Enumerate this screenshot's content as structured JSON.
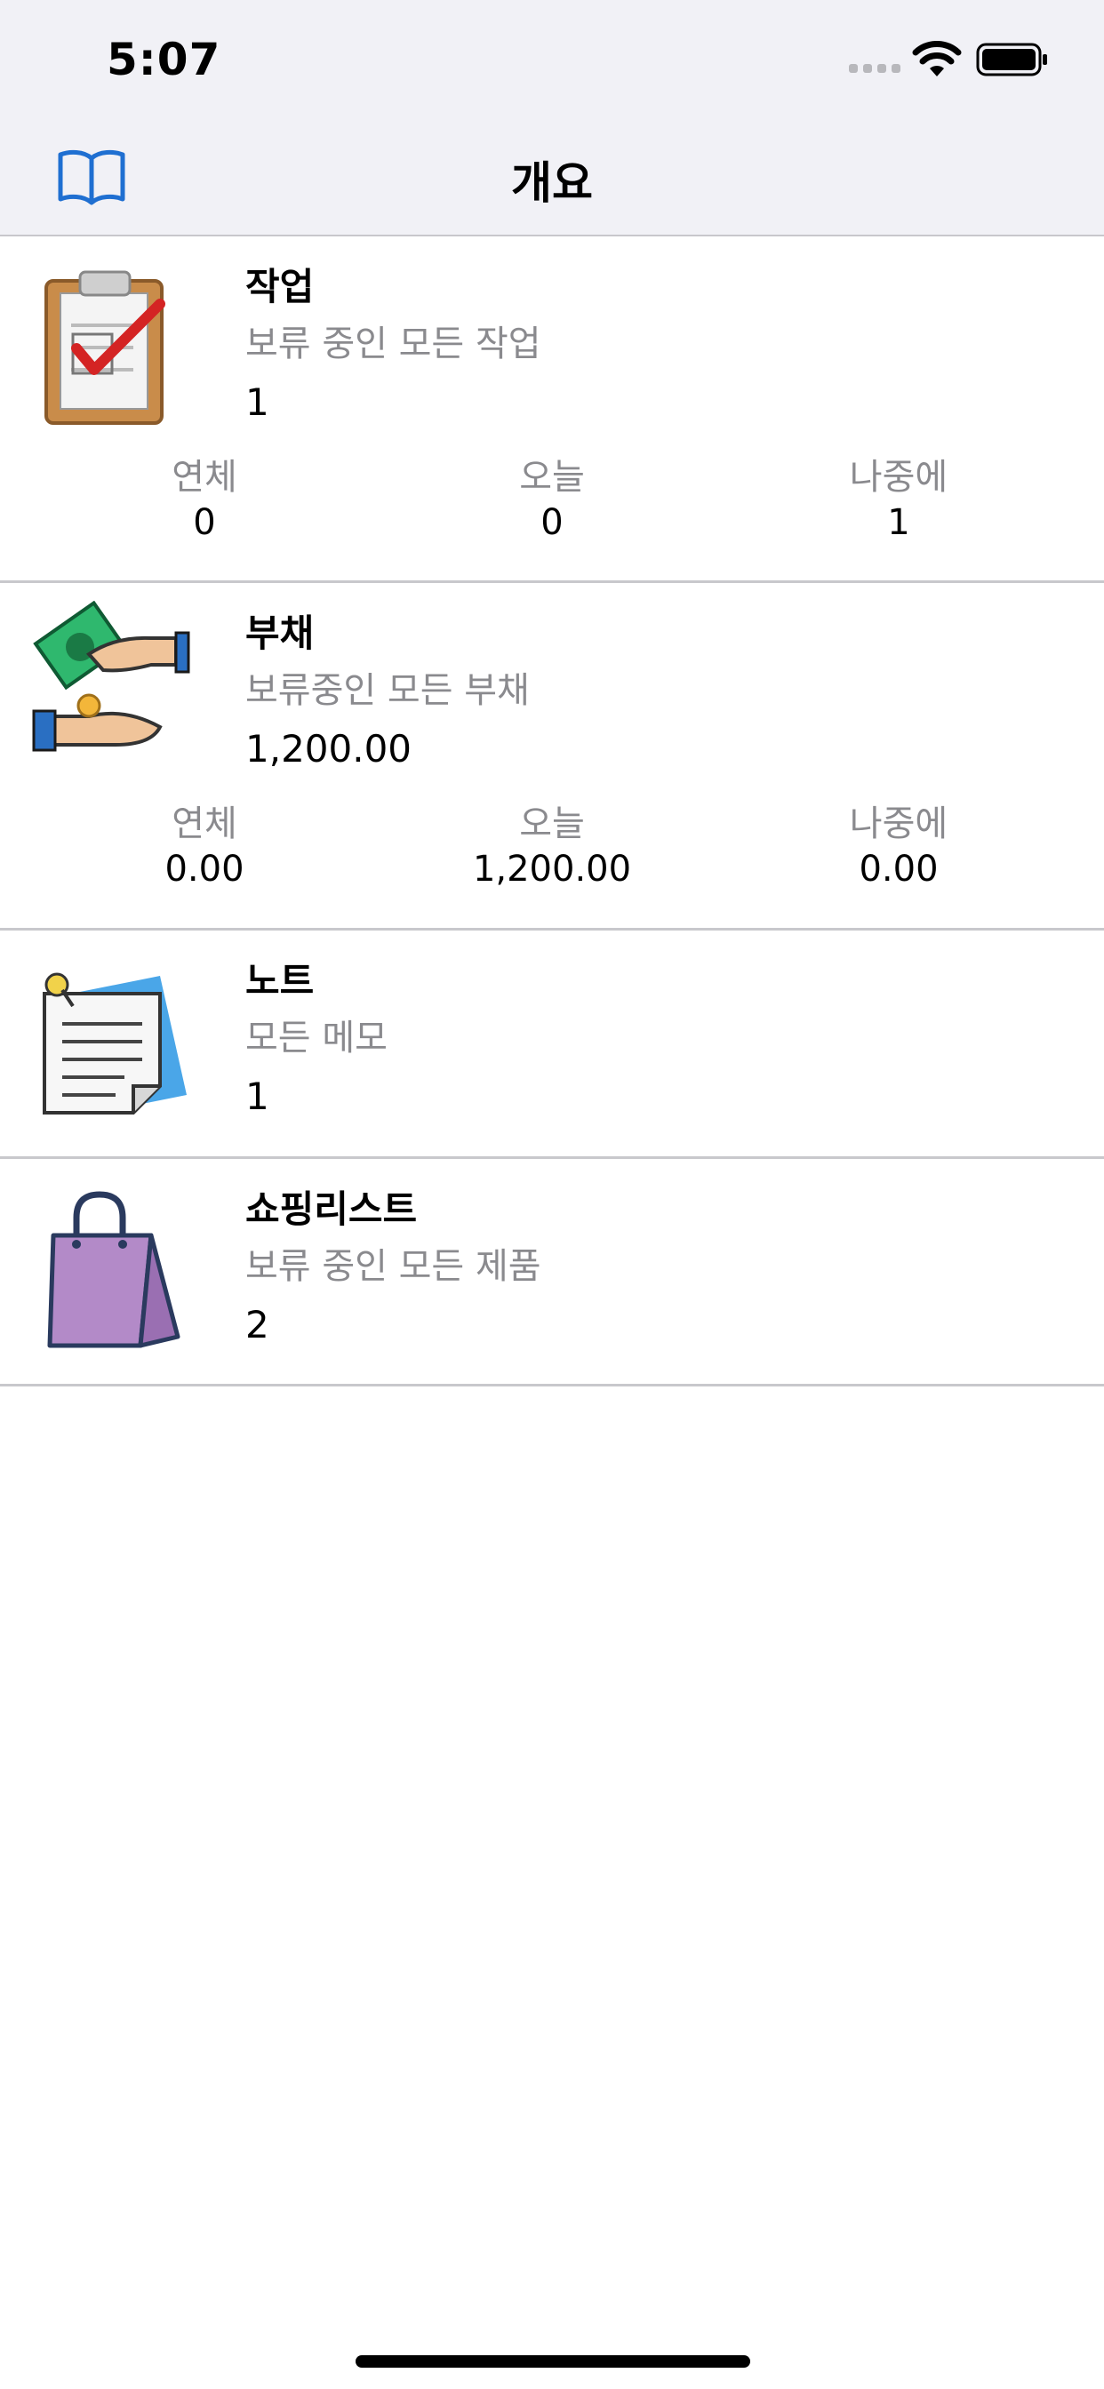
{
  "status_bar": {
    "time": "5:07"
  },
  "nav": {
    "title": "개요",
    "icon": "book-icon"
  },
  "rows": [
    {
      "icon": "clipboard-check-icon",
      "title": "작업",
      "subtitle": "보류 중인 모든 작업",
      "value": "1",
      "stats": [
        {
          "label": "연체",
          "value": "0"
        },
        {
          "label": "오늘",
          "value": "0"
        },
        {
          "label": "나중에",
          "value": "1"
        }
      ]
    },
    {
      "icon": "money-hands-icon",
      "title": "부채",
      "subtitle": "보류중인 모든 부채",
      "value": "1,200.00",
      "stats": [
        {
          "label": "연체",
          "value": "0.00"
        },
        {
          "label": "오늘",
          "value": "1,200.00"
        },
        {
          "label": "나중에",
          "value": "0.00"
        }
      ]
    },
    {
      "icon": "note-pin-icon",
      "title": "노트",
      "subtitle": "모든 메모",
      "value": "1"
    },
    {
      "icon": "shopping-bag-icon",
      "title": "쇼핑리스트",
      "subtitle": "보류 중인 모든 제품",
      "value": "2"
    }
  ],
  "colors": {
    "accent": "#1f6fd1",
    "secondary_text": "#8a8a8e",
    "bar_bg": "#f1f1f6"
  }
}
